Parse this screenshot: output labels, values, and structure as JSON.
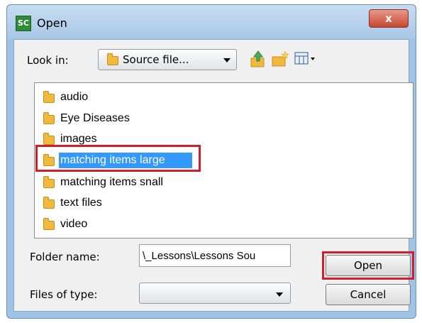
{
  "window": {
    "title": "Open",
    "app_icon_text": "SC",
    "close_symbol": "x"
  },
  "look_in": {
    "label": "Look in:",
    "value": "Source file..."
  },
  "toolbar": {
    "icons": [
      "up-folder-icon",
      "new-folder-icon",
      "view-menu-icon"
    ]
  },
  "file_list": {
    "items": [
      {
        "label": "audio",
        "selected": false
      },
      {
        "label": "Eye Diseases",
        "selected": false
      },
      {
        "label": "images",
        "selected": false
      },
      {
        "label": "matching items large",
        "selected": true
      },
      {
        "label": "matching items snall",
        "selected": false
      },
      {
        "label": "text files",
        "selected": false
      },
      {
        "label": "video",
        "selected": false
      }
    ]
  },
  "folder_name": {
    "label": "Folder name:",
    "value": "\\_Lessons\\Lessons Sou"
  },
  "files_of_type": {
    "label": "Files of type:",
    "value": ""
  },
  "buttons": {
    "open": "Open",
    "cancel": "Cancel"
  },
  "colors": {
    "selection": "#3399ff",
    "highlight_box": "#d11f2a",
    "window_frame": "#9fc3e6",
    "close_button": "#c6472f"
  }
}
